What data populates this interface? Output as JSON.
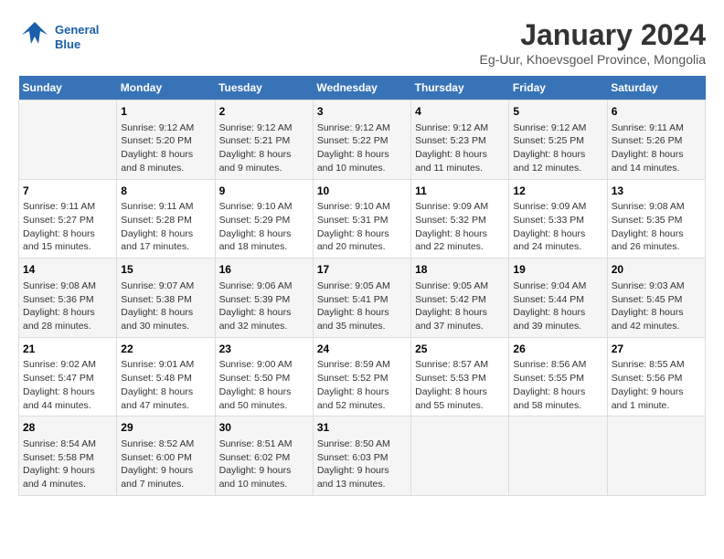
{
  "header": {
    "logo_line1": "General",
    "logo_line2": "Blue",
    "title": "January 2024",
    "subtitle": "Eg-Uur, Khoevsgoel Province, Mongolia"
  },
  "calendar": {
    "days_of_week": [
      "Sunday",
      "Monday",
      "Tuesday",
      "Wednesday",
      "Thursday",
      "Friday",
      "Saturday"
    ],
    "weeks": [
      [
        {
          "num": "",
          "info": ""
        },
        {
          "num": "1",
          "info": "Sunrise: 9:12 AM\nSunset: 5:20 PM\nDaylight: 8 hours\nand 8 minutes."
        },
        {
          "num": "2",
          "info": "Sunrise: 9:12 AM\nSunset: 5:21 PM\nDaylight: 8 hours\nand 9 minutes."
        },
        {
          "num": "3",
          "info": "Sunrise: 9:12 AM\nSunset: 5:22 PM\nDaylight: 8 hours\nand 10 minutes."
        },
        {
          "num": "4",
          "info": "Sunrise: 9:12 AM\nSunset: 5:23 PM\nDaylight: 8 hours\nand 11 minutes."
        },
        {
          "num": "5",
          "info": "Sunrise: 9:12 AM\nSunset: 5:25 PM\nDaylight: 8 hours\nand 12 minutes."
        },
        {
          "num": "6",
          "info": "Sunrise: 9:11 AM\nSunset: 5:26 PM\nDaylight: 8 hours\nand 14 minutes."
        }
      ],
      [
        {
          "num": "7",
          "info": "Sunrise: 9:11 AM\nSunset: 5:27 PM\nDaylight: 8 hours\nand 15 minutes."
        },
        {
          "num": "8",
          "info": "Sunrise: 9:11 AM\nSunset: 5:28 PM\nDaylight: 8 hours\nand 17 minutes."
        },
        {
          "num": "9",
          "info": "Sunrise: 9:10 AM\nSunset: 5:29 PM\nDaylight: 8 hours\nand 18 minutes."
        },
        {
          "num": "10",
          "info": "Sunrise: 9:10 AM\nSunset: 5:31 PM\nDaylight: 8 hours\nand 20 minutes."
        },
        {
          "num": "11",
          "info": "Sunrise: 9:09 AM\nSunset: 5:32 PM\nDaylight: 8 hours\nand 22 minutes."
        },
        {
          "num": "12",
          "info": "Sunrise: 9:09 AM\nSunset: 5:33 PM\nDaylight: 8 hours\nand 24 minutes."
        },
        {
          "num": "13",
          "info": "Sunrise: 9:08 AM\nSunset: 5:35 PM\nDaylight: 8 hours\nand 26 minutes."
        }
      ],
      [
        {
          "num": "14",
          "info": "Sunrise: 9:08 AM\nSunset: 5:36 PM\nDaylight: 8 hours\nand 28 minutes."
        },
        {
          "num": "15",
          "info": "Sunrise: 9:07 AM\nSunset: 5:38 PM\nDaylight: 8 hours\nand 30 minutes."
        },
        {
          "num": "16",
          "info": "Sunrise: 9:06 AM\nSunset: 5:39 PM\nDaylight: 8 hours\nand 32 minutes."
        },
        {
          "num": "17",
          "info": "Sunrise: 9:05 AM\nSunset: 5:41 PM\nDaylight: 8 hours\nand 35 minutes."
        },
        {
          "num": "18",
          "info": "Sunrise: 9:05 AM\nSunset: 5:42 PM\nDaylight: 8 hours\nand 37 minutes."
        },
        {
          "num": "19",
          "info": "Sunrise: 9:04 AM\nSunset: 5:44 PM\nDaylight: 8 hours\nand 39 minutes."
        },
        {
          "num": "20",
          "info": "Sunrise: 9:03 AM\nSunset: 5:45 PM\nDaylight: 8 hours\nand 42 minutes."
        }
      ],
      [
        {
          "num": "21",
          "info": "Sunrise: 9:02 AM\nSunset: 5:47 PM\nDaylight: 8 hours\nand 44 minutes."
        },
        {
          "num": "22",
          "info": "Sunrise: 9:01 AM\nSunset: 5:48 PM\nDaylight: 8 hours\nand 47 minutes."
        },
        {
          "num": "23",
          "info": "Sunrise: 9:00 AM\nSunset: 5:50 PM\nDaylight: 8 hours\nand 50 minutes."
        },
        {
          "num": "24",
          "info": "Sunrise: 8:59 AM\nSunset: 5:52 PM\nDaylight: 8 hours\nand 52 minutes."
        },
        {
          "num": "25",
          "info": "Sunrise: 8:57 AM\nSunset: 5:53 PM\nDaylight: 8 hours\nand 55 minutes."
        },
        {
          "num": "26",
          "info": "Sunrise: 8:56 AM\nSunset: 5:55 PM\nDaylight: 8 hours\nand 58 minutes."
        },
        {
          "num": "27",
          "info": "Sunrise: 8:55 AM\nSunset: 5:56 PM\nDaylight: 9 hours\nand 1 minute."
        }
      ],
      [
        {
          "num": "28",
          "info": "Sunrise: 8:54 AM\nSunset: 5:58 PM\nDaylight: 9 hours\nand 4 minutes."
        },
        {
          "num": "29",
          "info": "Sunrise: 8:52 AM\nSunset: 6:00 PM\nDaylight: 9 hours\nand 7 minutes."
        },
        {
          "num": "30",
          "info": "Sunrise: 8:51 AM\nSunset: 6:02 PM\nDaylight: 9 hours\nand 10 minutes."
        },
        {
          "num": "31",
          "info": "Sunrise: 8:50 AM\nSunset: 6:03 PM\nDaylight: 9 hours\nand 13 minutes."
        },
        {
          "num": "",
          "info": ""
        },
        {
          "num": "",
          "info": ""
        },
        {
          "num": "",
          "info": ""
        }
      ]
    ]
  }
}
